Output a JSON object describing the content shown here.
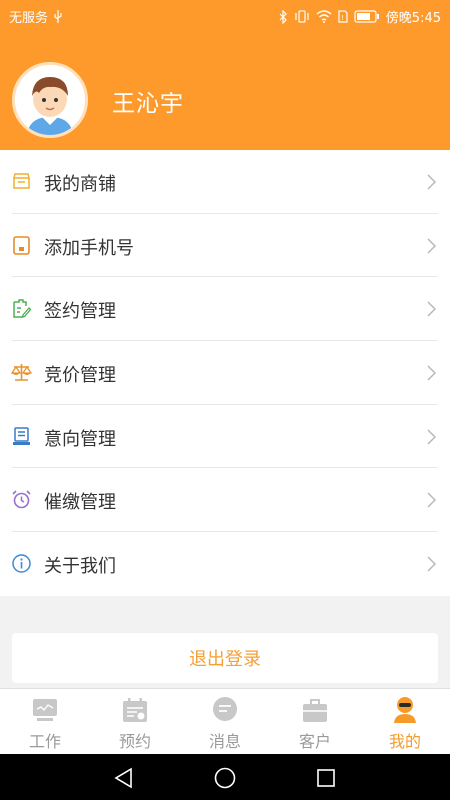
{
  "status_bar": {
    "carrier": "无服务",
    "time": "傍晚5:45",
    "icons": [
      "usb-icon",
      "bluetooth-icon",
      "vibrate-icon",
      "wifi-icon",
      "sim-icon",
      "battery-icon"
    ]
  },
  "profile": {
    "name": "王沁宇",
    "avatar_icon": "boy-avatar-icon"
  },
  "menu": {
    "items": [
      {
        "label": "我的商铺",
        "icon": "shop-icon",
        "color": "#f0b030"
      },
      {
        "label": "添加手机号",
        "icon": "tablet-icon",
        "color": "#e88a2a"
      },
      {
        "label": "签约管理",
        "icon": "contract-edit-icon",
        "color": "#4cb050"
      },
      {
        "label": "竞价管理",
        "icon": "scale-icon",
        "color": "#e8932a"
      },
      {
        "label": "意向管理",
        "icon": "list-doc-icon",
        "color": "#3a7ac8"
      },
      {
        "label": "催缴管理",
        "icon": "alarm-clock-icon",
        "color": "#9b6fd0"
      },
      {
        "label": "关于我们",
        "icon": "info-icon",
        "color": "#3a8ad8"
      }
    ]
  },
  "logout": {
    "label": "退出登录",
    "color": "#f5a035"
  },
  "tabbar": {
    "tabs": [
      {
        "label": "工作",
        "icon": "monitor-icon",
        "active": false
      },
      {
        "label": "预约",
        "icon": "calendar-icon",
        "active": false
      },
      {
        "label": "消息",
        "icon": "chat-icon",
        "active": false
      },
      {
        "label": "客户",
        "icon": "briefcase-icon",
        "active": false
      },
      {
        "label": "我的",
        "icon": "person-icon",
        "active": true
      }
    ]
  },
  "colors": {
    "accent": "#fe9a2c",
    "active_tab": "#f59b2a",
    "inactive_tab": "#9a9a9a"
  }
}
